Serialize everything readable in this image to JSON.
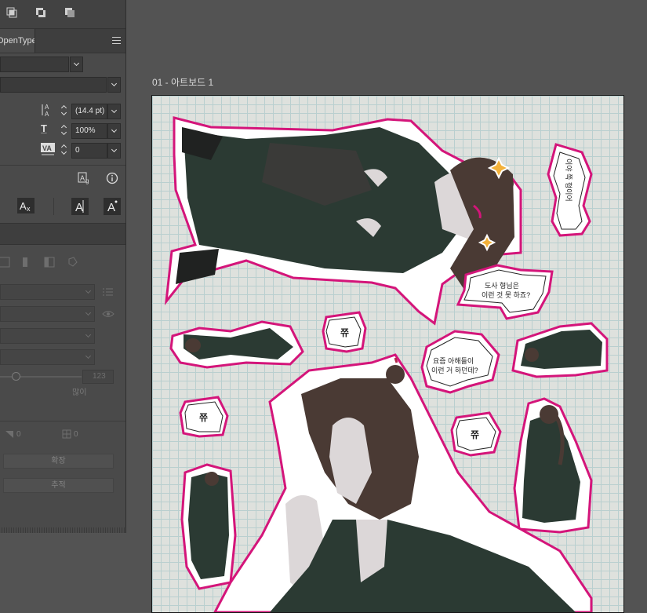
{
  "panel": {
    "tab_label": "OpenType",
    "leading_value": "(14.4 pt)",
    "scale_value": "100%",
    "tracking_value": "0",
    "stroke_label": "많이",
    "stroke_value": "123",
    "corner_left_value": "0",
    "corner_right_value": "0",
    "expand_button": "확장",
    "trace_button": "추적"
  },
  "artboard": {
    "label": "01 - 아트보드 1"
  },
  "stickers": {
    "vertical_bubble": "이야 쪽 형이어",
    "bubble_1_line1": "도사 형님은",
    "bubble_1_line2": "이런 것 못 하죠?",
    "bubble_2_line1": "요즘 아해들이",
    "bubble_2_line2": "이런 거 하던데?",
    "sfx_1": "쮸",
    "sfx_2": "쮸",
    "sfx_3": "쮸"
  },
  "colors": {
    "sticker_outline": "#d4157a",
    "robe": "#2b3a33",
    "skin": "#dcd7d8",
    "hair": "#4a3a34"
  }
}
